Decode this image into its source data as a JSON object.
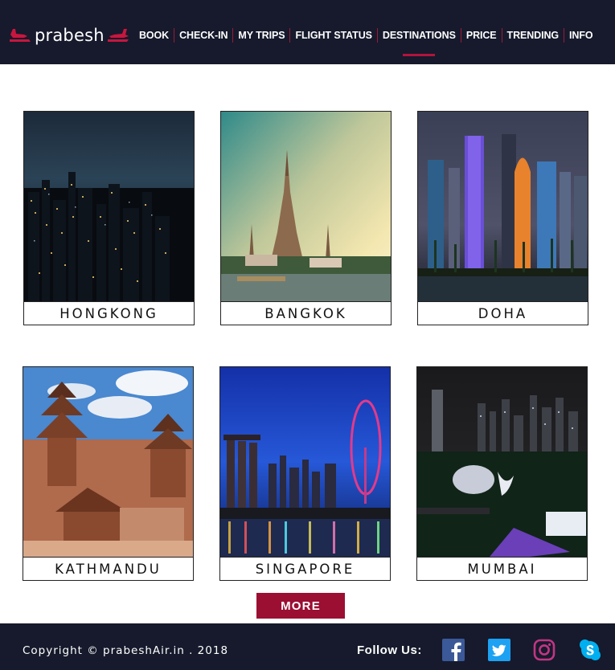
{
  "brand": {
    "name": "prabesh",
    "accent": "#b3133d",
    "header_bg": "#161a2c"
  },
  "nav": {
    "items": [
      {
        "label": "BOOK"
      },
      {
        "label": "CHECK-IN"
      },
      {
        "label": "MY TRIPS"
      },
      {
        "label": "FLIGHT STATUS"
      },
      {
        "label": "DESTINATIONS",
        "active": true
      },
      {
        "label": "PRICE"
      },
      {
        "label": "TRENDING"
      },
      {
        "label": "INFO"
      }
    ]
  },
  "destinations": [
    {
      "name": "HONGKONG",
      "image": "night-skyline-photo"
    },
    {
      "name": "BANGKOK",
      "image": "temple-photo"
    },
    {
      "name": "DOHA",
      "image": "lit-towers-photo"
    },
    {
      "name": "KATHMANDU",
      "image": "pagoda-square-photo"
    },
    {
      "name": "SINGAPORE",
      "image": "marina-ferris-wheel-photo"
    },
    {
      "name": "MUMBAI",
      "image": "harbour-night-photo"
    }
  ],
  "more_label": "MORE",
  "footer": {
    "copyright": "Copyright © prabeshAir.in . 2018",
    "follow_label": "Follow Us:",
    "social": [
      {
        "icon": "facebook-icon",
        "color": "#3b5998"
      },
      {
        "icon": "twitter-icon",
        "color": "#1da1f2"
      },
      {
        "icon": "instagram-icon",
        "color": "#c13584"
      },
      {
        "icon": "skype-icon",
        "color": "#00aff0"
      }
    ]
  }
}
